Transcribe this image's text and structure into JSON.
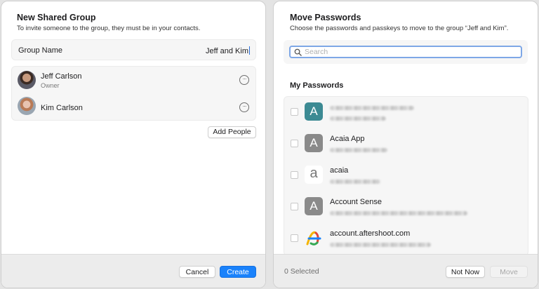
{
  "left_dialog": {
    "title": "New Shared Group",
    "subtitle": "To invite someone to the group, they must be in your contacts.",
    "group_name_label": "Group Name",
    "group_name_value": "Jeff and Kim",
    "people": [
      {
        "name": "Jeff Carlson",
        "role": "Owner"
      },
      {
        "name": "Kim Carlson",
        "role": ""
      }
    ],
    "more_glyph": "···",
    "add_people_label": "Add People",
    "cancel_label": "Cancel",
    "create_label": "Create"
  },
  "right_dialog": {
    "title": "Move Passwords",
    "subtitle": "Choose the passwords and passkeys to move to the group “Jeff and Kim”.",
    "search_placeholder": "Search",
    "section_title": "My Passwords",
    "items": [
      {
        "title": "",
        "icon_letter": "A",
        "icon": "letter-a-teal-icon"
      },
      {
        "title": "Acaia App",
        "icon_letter": "A",
        "icon": "letter-a-gray-icon"
      },
      {
        "title": "acaia",
        "icon_letter": "a",
        "icon": "acaia-logo-icon"
      },
      {
        "title": "Account Sense",
        "icon_letter": "A",
        "icon": "letter-a-gray-icon"
      },
      {
        "title": "account.aftershoot.com",
        "icon_letter": "",
        "icon": "aftershoot-logo-icon"
      }
    ],
    "selected_count": "0 Selected",
    "not_now_label": "Not Now",
    "move_label": "Move"
  },
  "colors": {
    "accent": "#1a82fb",
    "icon_teal": "#3c8a93",
    "icon_gray": "#8a8a8a",
    "focus_ring": "#7ea7e6"
  }
}
